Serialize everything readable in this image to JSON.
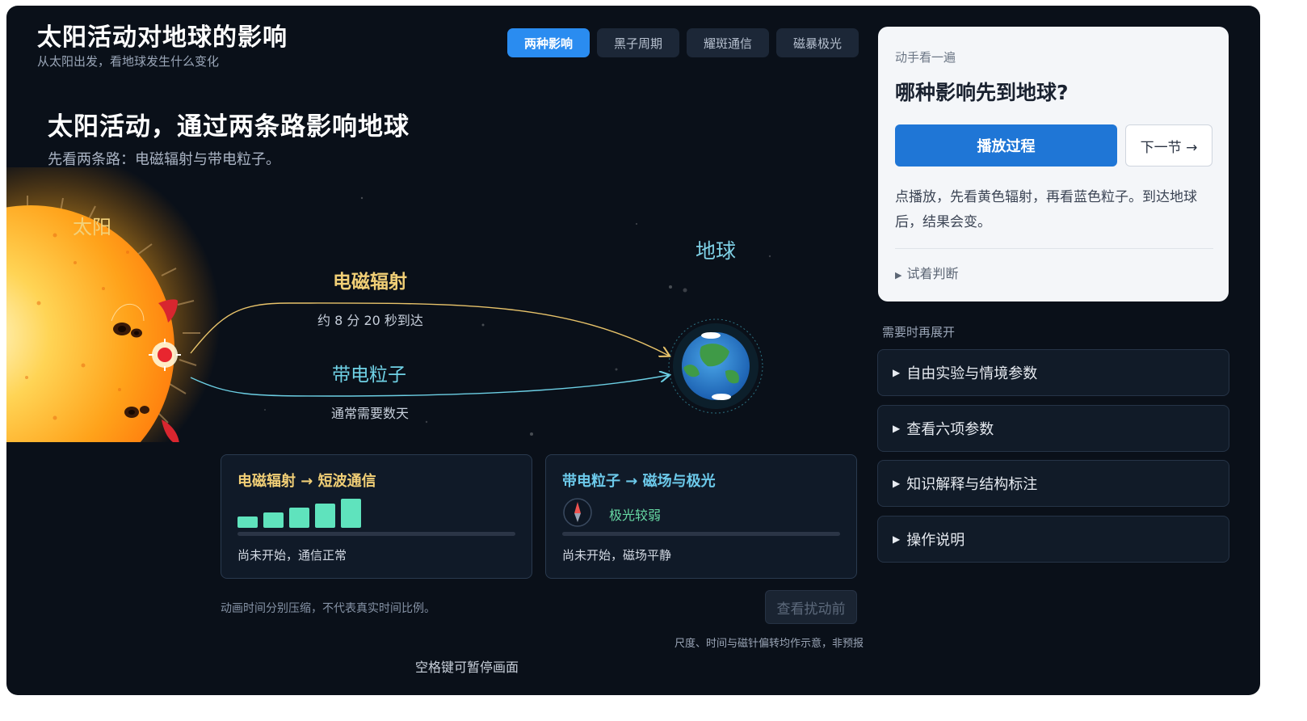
{
  "app": {
    "title": "太阳活动对地球的影响",
    "subtitle": "从太阳出发，看地球发生什么变化"
  },
  "tabs": [
    {
      "label": "两种影响",
      "active": true
    },
    {
      "label": "黑子周期",
      "active": false
    },
    {
      "label": "耀斑通信",
      "active": false
    },
    {
      "label": "磁暴极光",
      "active": false
    }
  ],
  "main": {
    "headline": "太阳活动，通过两条路影响地球",
    "lede": "先看两条路：电磁辐射与带电粒子。",
    "sun_label": "太阳",
    "earth_label": "地球",
    "radiation": {
      "label": "电磁辐射",
      "note": "约 8 分 20 秒到达"
    },
    "particles": {
      "label": "带电粒子",
      "note": "通常需要数天"
    }
  },
  "cards": {
    "radio": {
      "title": "电磁辐射 → 短波通信",
      "signal_levels": [
        1,
        2,
        3,
        4,
        5
      ],
      "status": "尚未开始，通信正常"
    },
    "magnet": {
      "title": "带电粒子 → 磁场与极光",
      "aurora": "极光较弱",
      "status": "尚未开始，磁场平静"
    }
  },
  "footnote": "动画时间分别压缩，不代表真实时间比例。",
  "before_button": "查看扰动前",
  "disclaimer": "尺度、时间与磁针偏转均作示意，非预报",
  "pause_hint": "空格键可暂停画面",
  "panel": {
    "kicker": "动手看一遍",
    "question": "哪种影响先到地球?",
    "play_label": "播放过程",
    "next_label": "下一节 →",
    "description": "点播放，先看黄色辐射，再看蓝色粒子。到达地球后，结果会变。",
    "try_label": "试着判断"
  },
  "expand_hint": "需要时再展开",
  "accordions": [
    {
      "label": "自由实验与情境参数"
    },
    {
      "label": "查看六项参数"
    },
    {
      "label": "知识解释与结构标注"
    },
    {
      "label": "操作说明"
    }
  ],
  "colors": {
    "radiation": "#e8c36a",
    "particles": "#6ccfe4",
    "accent": "#2a8cf0",
    "signal": "#5fe3bd",
    "aurora_text": "#67d9a4"
  }
}
